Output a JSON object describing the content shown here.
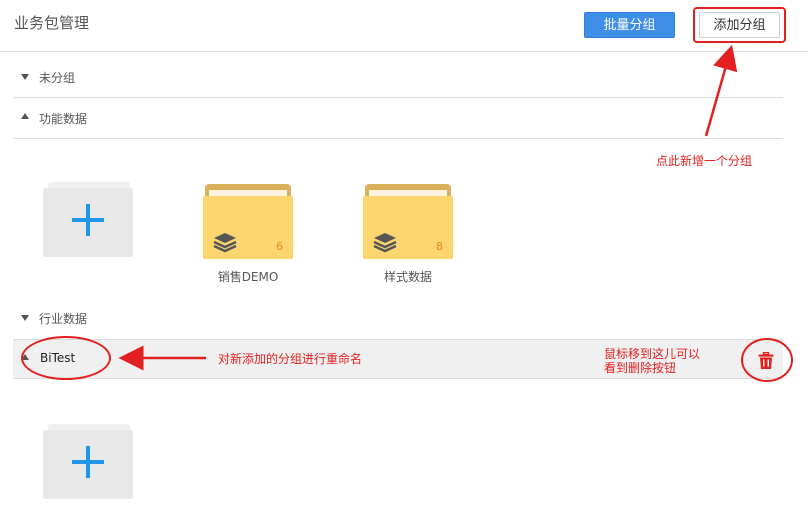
{
  "header": {
    "title": "业务包管理",
    "batch_button": "批量分组",
    "add_button": "添加分组"
  },
  "groups": [
    {
      "label": "未分组",
      "expanded": false
    },
    {
      "label": "功能数据",
      "expanded": true
    },
    {
      "label": "行业数据",
      "expanded": false
    },
    {
      "label": "BiTest",
      "expanded": true
    }
  ],
  "folders": [
    {
      "name": "销售DEMO",
      "count": "6"
    },
    {
      "name": "样式数据",
      "count": "8"
    }
  ],
  "icons": {
    "add_folder": "plus-icon",
    "package_folder": "layers-icon",
    "delete": "trash-icon"
  },
  "annotations": {
    "add_group_hint": "点此新增一个分组",
    "rename_hint": "对新添加的分组进行重命名",
    "delete_hint_line1": "鼠标移到这儿可以",
    "delete_hint_line2": "看到删除按钮"
  },
  "colors": {
    "primary": "#3f8fe8",
    "folder": "#fcd56e",
    "annotation": "#e32020",
    "plus": "#2196e9"
  }
}
